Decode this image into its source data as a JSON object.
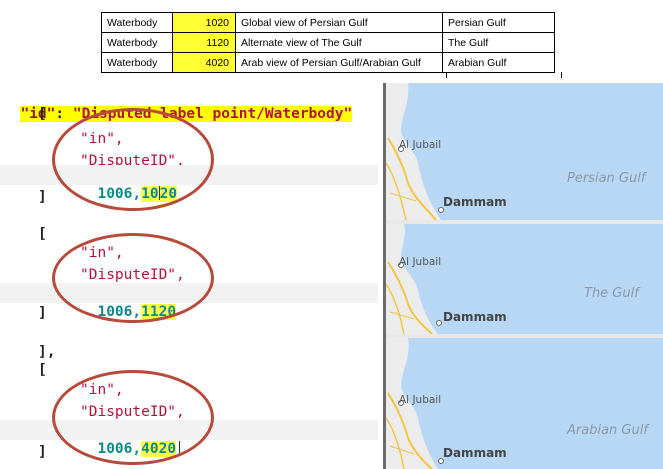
{
  "table": {
    "rows": [
      {
        "type": "Waterbody",
        "id": "1020",
        "description": "Global view of Persian Gulf",
        "label": "Persian Gulf"
      },
      {
        "type": "Waterbody",
        "id": "1120",
        "description": "Alternate view of The Gulf",
        "label": "The Gulf"
      },
      {
        "type": "Waterbody",
        "id": "4020",
        "description": "Arab view of Persian Gulf/Arabian Gulf",
        "label": "Arabian Gulf"
      }
    ]
  },
  "code": {
    "id_key": "\"id\"",
    "colon": ":",
    "id_value": "\"Disputed label point/Waterbody\"",
    "blocks": [
      {
        "open": "[",
        "op": "\"in\",",
        "field": "\"DisputeID\",",
        "num_a": "1006,",
        "num_b_pre": "1",
        "num_b_post": "20",
        "num_b_mid": "0",
        "close": "]"
      },
      {
        "open": "[",
        "op": "\"in\",",
        "field": "\"DisputeID\",",
        "num_a": "1006,",
        "num_b": "1120",
        "close": "]"
      },
      {
        "prefix": "],",
        "open": "[",
        "op": "\"in\",",
        "field": "\"DisputeID\",",
        "num_a": "1006,",
        "num_b": "4020",
        "close": "]"
      }
    ]
  },
  "maps": [
    {
      "gulf_label": "Persian Gulf",
      "city_small": "Al Jubail",
      "city_big": "Dammam"
    },
    {
      "gulf_label": "The Gulf",
      "city_small": "Al Jubail",
      "city_big": "Dammam"
    },
    {
      "gulf_label": "Arabian Gulf",
      "city_small": "Al Jubail",
      "city_big": "Dammam"
    }
  ],
  "colors": {
    "table_highlight": "#ffff33",
    "ellipse": "#b84a3a",
    "water": "#b7d7f5",
    "land": "#ececec",
    "road": "#f5c542"
  }
}
